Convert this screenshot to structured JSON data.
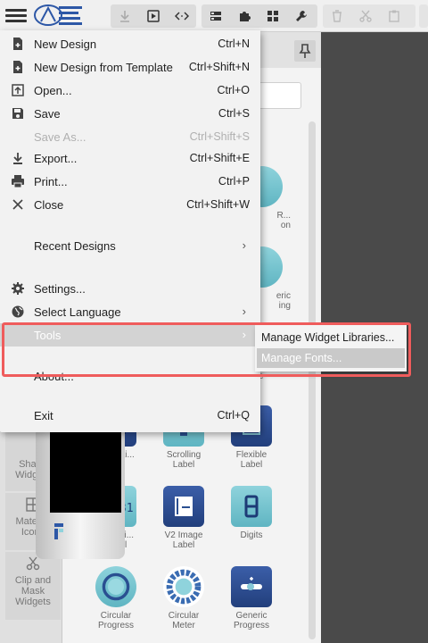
{
  "toolbar": {
    "menu_icon": "hamburger-icon",
    "logo": "app-logo",
    "buttons": [
      "download-icon",
      "play-icon",
      "code-icon",
      "layout-icon",
      "puzzle-icon",
      "grid-icon",
      "wrench-icon",
      "trash-icon",
      "scissors-icon",
      "clipboard-icon"
    ]
  },
  "categories": [
    {
      "label_line1": "Shape",
      "label_line2": "Widgets",
      "icon": "shape-icon"
    },
    {
      "label_line1": "Material",
      "label_line2": "Icons",
      "icon": "material-icon"
    },
    {
      "label_line1": "Clip and",
      "label_line2": "Mask",
      "label_line3": "Widgets",
      "icon": "scissors-icon"
    }
  ],
  "widgets": [
    {
      "line1": "Animati...",
      "line2": ""
    },
    {
      "line1": "Scrolling",
      "line2": "Label"
    },
    {
      "line1": "Flexible",
      "line2": "Label"
    },
    {
      "line1": "Date/Ti...",
      "line2": "Label"
    },
    {
      "line1": "V2 Image",
      "line2": "Label"
    },
    {
      "line1": "Digits",
      "line2": ""
    },
    {
      "line1": "Circular",
      "line2": "Progress"
    },
    {
      "line1": "Circular",
      "line2": "Meter"
    },
    {
      "line1": "Generic",
      "line2": "Progress"
    }
  ],
  "widget_partial_labels": {
    "r1": "R...",
    "r1b": "on",
    "r2": "eric",
    "r2b": "ing",
    "r3": "e"
  },
  "menu": {
    "items": [
      {
        "label": "New Design",
        "shortcut": "Ctrl+N",
        "icon": "new-file-icon"
      },
      {
        "label": "New Design from Template",
        "shortcut": "Ctrl+Shift+N",
        "icon": "template-icon"
      },
      {
        "label": "Open...",
        "shortcut": "Ctrl+O",
        "icon": "open-icon"
      },
      {
        "label": "Save",
        "shortcut": "Ctrl+S",
        "icon": "save-icon"
      },
      {
        "label": "Save As...",
        "shortcut": "Ctrl+Shift+S",
        "icon": ""
      },
      {
        "label": "Export...",
        "shortcut": "Ctrl+Shift+E",
        "icon": "export-icon"
      },
      {
        "label": "Print...",
        "shortcut": "Ctrl+P",
        "icon": "print-icon"
      },
      {
        "label": "Close",
        "shortcut": "Ctrl+Shift+W",
        "icon": "close-icon"
      },
      {
        "label": "Recent Designs",
        "shortcut": "",
        "icon": ""
      },
      {
        "label": "Settings...",
        "shortcut": "",
        "icon": "gear-icon"
      },
      {
        "label": "Select Language",
        "shortcut": "",
        "icon": "globe-icon"
      },
      {
        "label": "Tools",
        "shortcut": "",
        "icon": ""
      },
      {
        "label": "About...",
        "shortcut": "",
        "icon": ""
      },
      {
        "label": "Exit",
        "shortcut": "Ctrl+Q",
        "icon": ""
      }
    ],
    "submenu_arrow": "›"
  },
  "submenu": {
    "items": [
      "Manage Widget Libraries...",
      "Manage Fonts..."
    ]
  },
  "colors": {
    "highlight": "#ef5c5c",
    "accent_teal": "#5fb5c2",
    "accent_navy": "#223f7c"
  }
}
